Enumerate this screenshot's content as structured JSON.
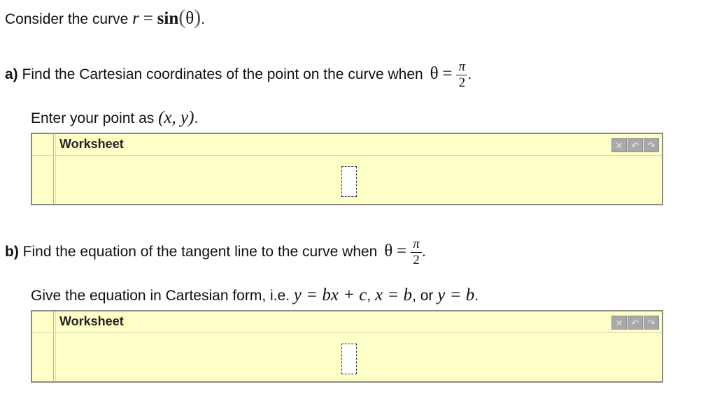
{
  "intro": {
    "text": "Consider the curve",
    "eq_lhs": "r",
    "eq_sign": "=",
    "func": "sin",
    "arg": "θ",
    "end": "."
  },
  "part_a": {
    "label": "a)",
    "text": "Find the Cartesian coordinates of the point on the curve when",
    "theta": "θ",
    "eq": "=",
    "frac_num": "π",
    "frac_den": "2",
    "end": ".",
    "instruction": "Enter your point as",
    "point": "(x, y)",
    "instruction_end": ".",
    "worksheet": {
      "title": "Worksheet",
      "buttons": [
        "✕",
        "↶",
        "↷"
      ]
    }
  },
  "part_b": {
    "label": "b)",
    "text": "Find the equation of the tangent line to the curve when",
    "theta": "θ",
    "eq": "=",
    "frac_num": "π",
    "frac_den": "2",
    "end": ".",
    "instruction": "Give the equation in Cartesian form, i.e.",
    "form1": "y = bx + c",
    "sep1": ",",
    "form2": "x = b",
    "sep2": ", or",
    "form3": "y = b",
    "instruction_end": ".",
    "worksheet": {
      "title": "Worksheet",
      "buttons": [
        "✕",
        "↶",
        "↷"
      ]
    }
  }
}
